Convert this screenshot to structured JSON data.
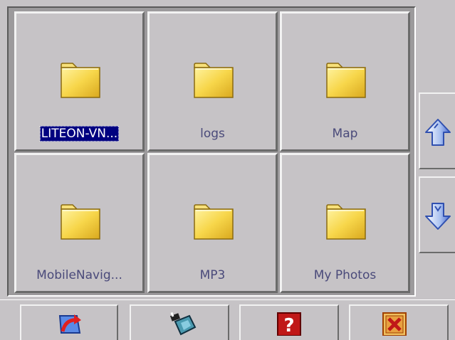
{
  "folders": [
    {
      "label": "LITEON-VN...",
      "icon": "folder-icon",
      "selected": true
    },
    {
      "label": "logs",
      "icon": "folder-icon",
      "selected": false
    },
    {
      "label": "Map",
      "icon": "folder-icon",
      "selected": false
    },
    {
      "label": "MobileNavig...",
      "icon": "folder-icon",
      "selected": false
    },
    {
      "label": "MP3",
      "icon": "folder-icon",
      "selected": false
    },
    {
      "label": "My Photos",
      "icon": "folder-icon",
      "selected": false
    }
  ],
  "scroll": {
    "up_icon": "arrow-up-icon",
    "down_icon": "arrow-down-icon"
  },
  "toolbar": {
    "buttons": [
      {
        "icon": "back-arrow-icon"
      },
      {
        "icon": "media-clapper-icon"
      },
      {
        "icon": "help-icon"
      },
      {
        "icon": "close-icon"
      }
    ]
  },
  "colors": {
    "background": "#c6c3c6",
    "selection": "#000080",
    "label_text": "#4a4a7a",
    "folder_yellow": "#f7d64a",
    "arrow_blue": "#6b8ee6",
    "help_red": "#c01818"
  }
}
